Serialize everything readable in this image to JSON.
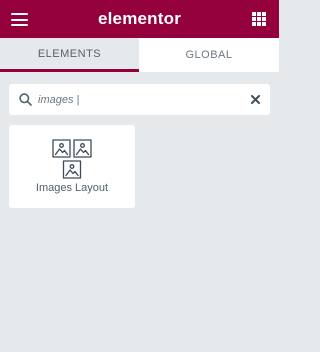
{
  "header": {
    "logo_text": "elementor",
    "menu_icon": "hamburger-icon",
    "apps_icon": "grid-icon"
  },
  "tabs": [
    {
      "label": "ELEMENTS",
      "active": true
    },
    {
      "label": "GLOBAL",
      "active": false
    }
  ],
  "search": {
    "value": "images |",
    "icon": "search-icon",
    "clear_icon": "close-icon"
  },
  "widgets": [
    {
      "label": "Images Layout",
      "icon": "images-layout-icon"
    }
  ],
  "colors": {
    "brand": "#93003c",
    "panel_bg": "#e6e9ec",
    "text": "#556068"
  }
}
